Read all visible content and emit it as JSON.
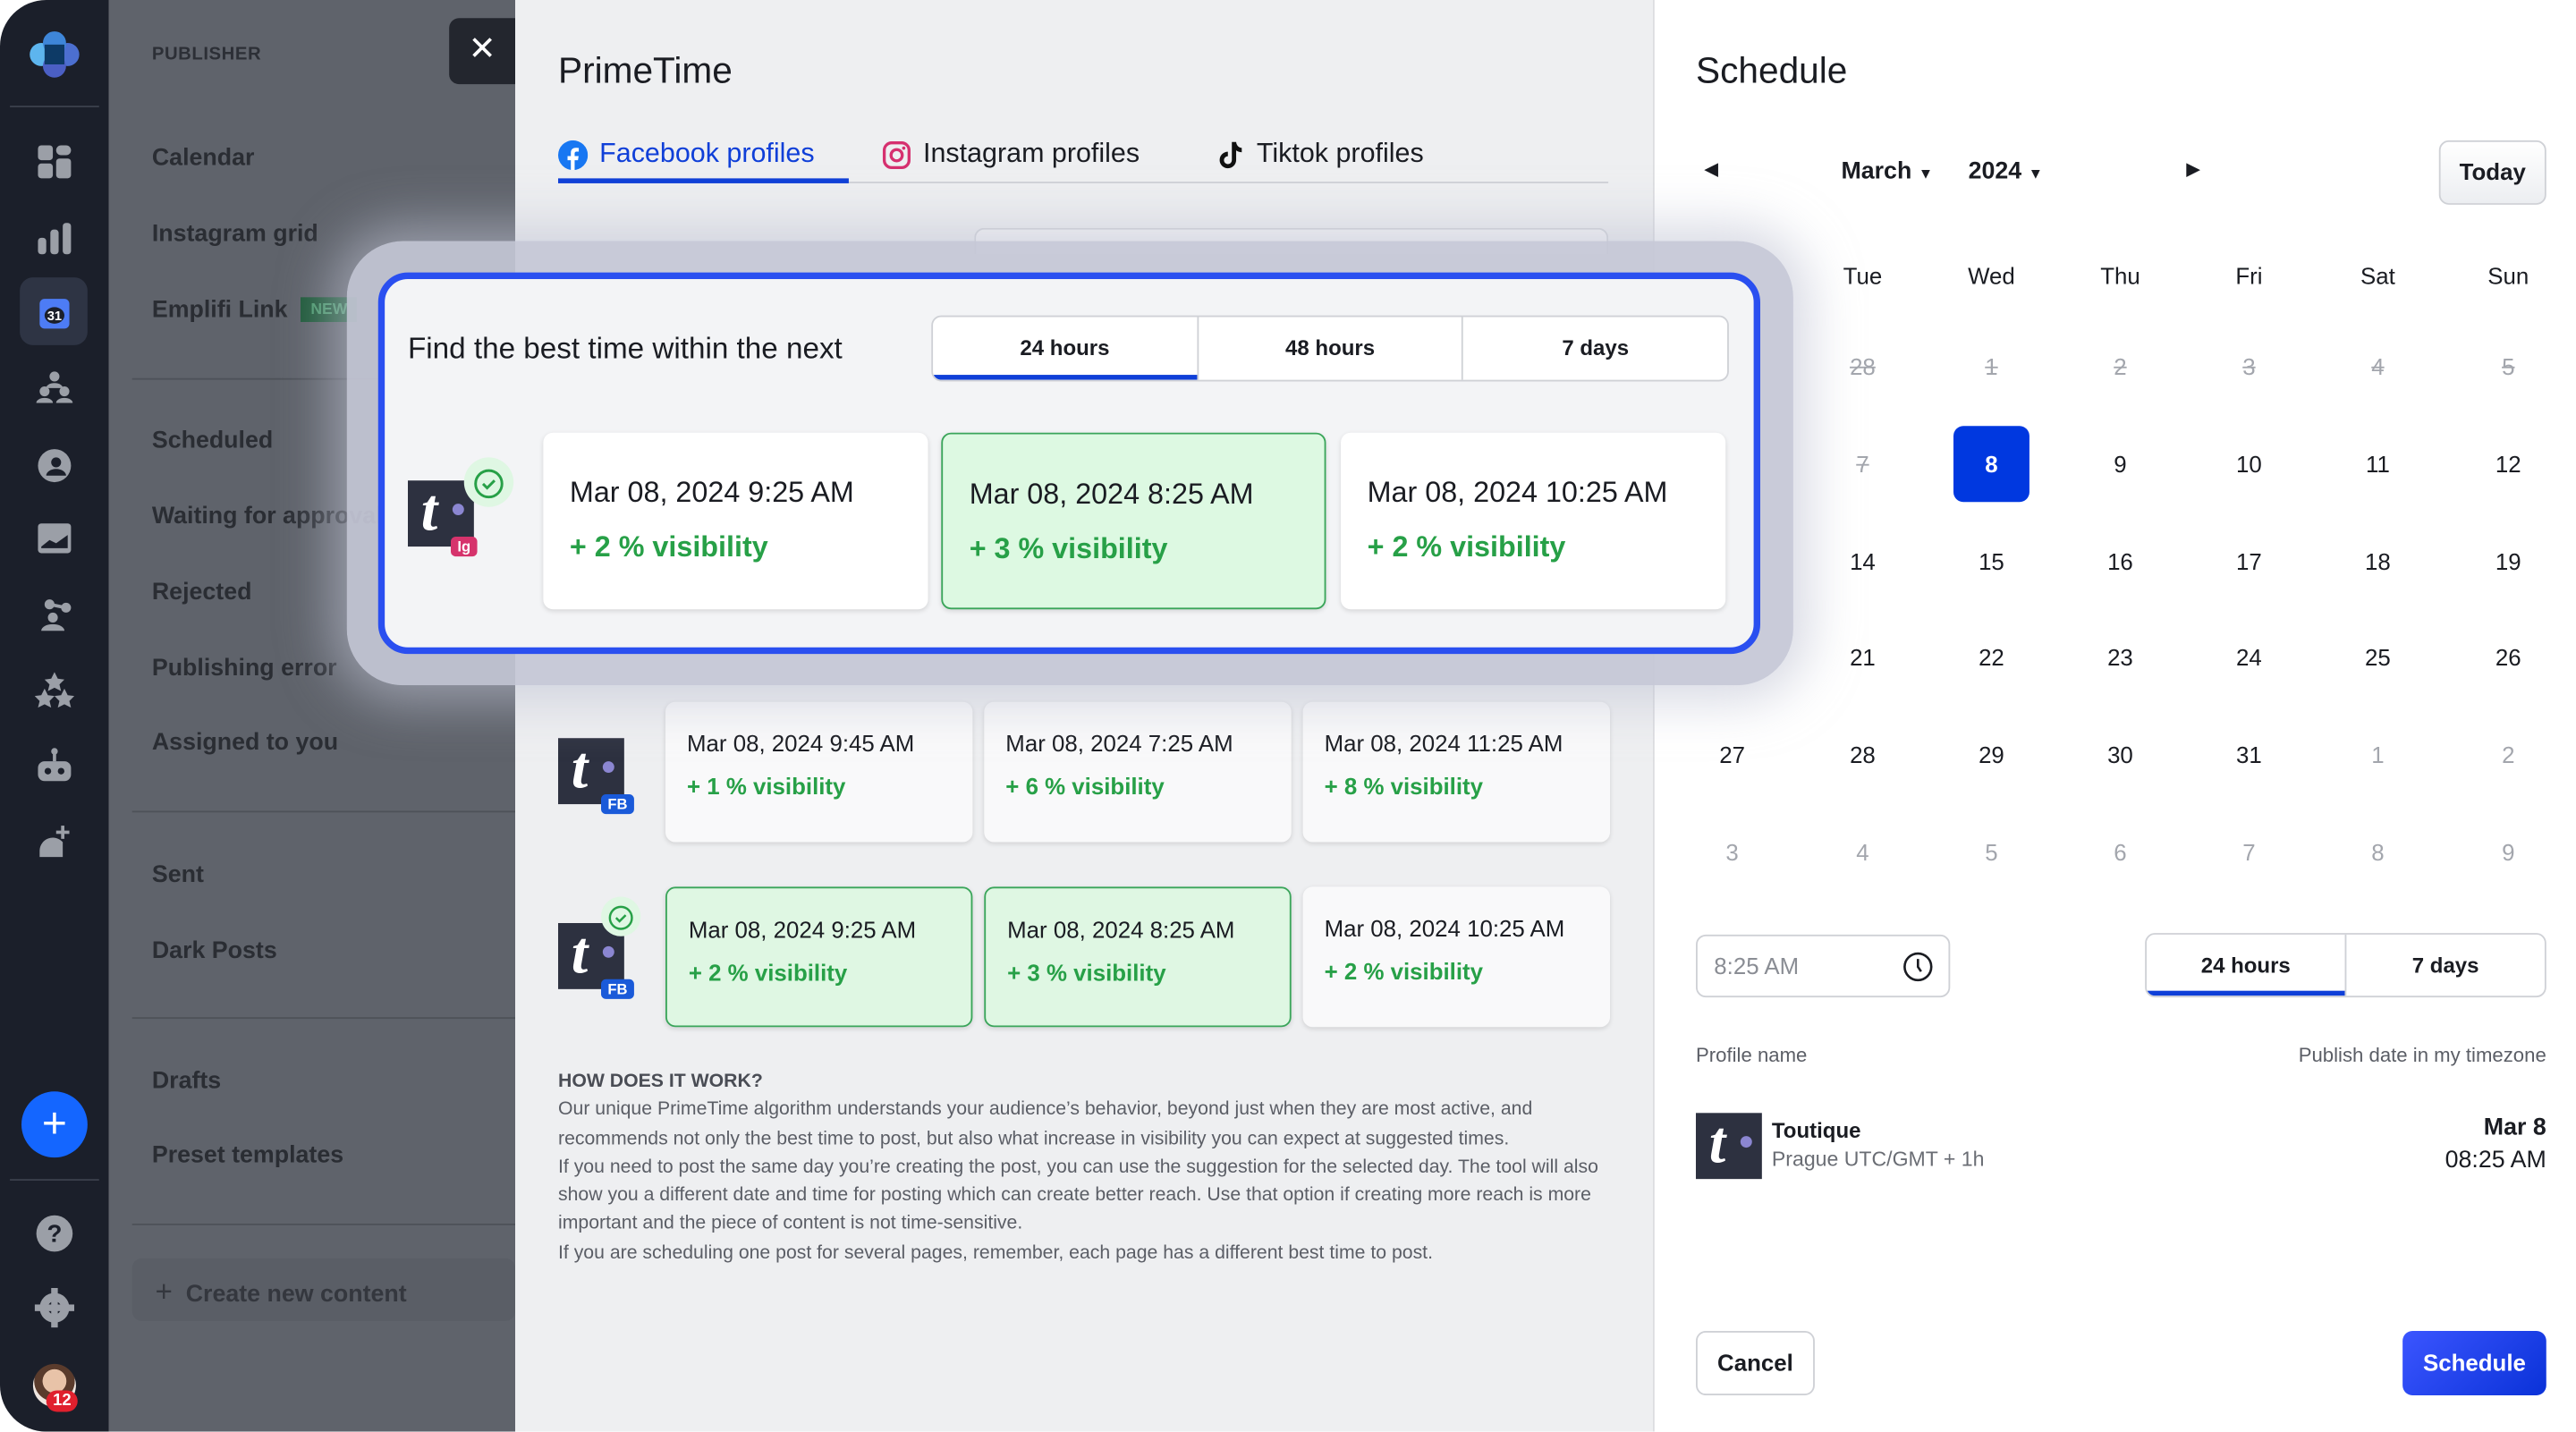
{
  "colors": {
    "accent": "#0f3fd8",
    "selected_day": "#0038e0",
    "success": "#27a047",
    "best_bg": "#ddf9e2",
    "rail": "#1b1f2a",
    "badge_ig": "#d6336c",
    "badge_fb": "#1a5ad9"
  },
  "rail": {
    "items": [
      "dashboard-icon",
      "analytics-icon",
      "calendar-icon",
      "community-icon",
      "care-icon",
      "media-icon",
      "influencer-icon",
      "reviews-icon",
      "bot-icon",
      "listening-icon"
    ],
    "active": "calendar-icon",
    "calendar_day": "31",
    "notifications": "12"
  },
  "nav": {
    "header": "PUBLISHER",
    "groups": [
      [
        "Calendar",
        "Instagram grid",
        "Emplifi Link"
      ],
      [
        "Scheduled",
        "Waiting for approval",
        "Rejected",
        "Publishing error",
        "Assigned to you"
      ],
      [
        "Sent",
        "Dark Posts"
      ],
      [
        "Drafts",
        "Preset templates"
      ]
    ],
    "new_badge": "NEW",
    "create_label": "Create new content"
  },
  "primetime": {
    "title": "PrimeTime",
    "tabs": [
      {
        "label": "Facebook profiles",
        "icon": "facebook-icon",
        "active": true
      },
      {
        "label": "Instagram profiles",
        "icon": "instagram-icon"
      },
      {
        "label": "Tiktok profiles",
        "icon": "tiktok-icon"
      }
    ],
    "popup": {
      "question": "Find the best time within the next",
      "ranges": [
        "24 hours",
        "48 hours",
        "7 days"
      ],
      "active_range": "24 hours",
      "badge": "Ig",
      "slots": [
        {
          "date": "Mar 08, 2024 9:25 AM",
          "visibility": "+ 2 % visibility"
        },
        {
          "date": "Mar 08, 2024 8:25 AM",
          "visibility": "+ 3 % visibility",
          "best": true
        },
        {
          "date": "Mar 08, 2024 10:25 AM",
          "visibility": "+ 2 % visibility"
        }
      ]
    },
    "rows": [
      {
        "badge": "FB",
        "slots": [
          {
            "date": "Mar 08, 2024 9:45 AM",
            "visibility": "+ 1 % visibility"
          },
          {
            "date": "Mar 08, 2024 7:25 AM",
            "visibility": "+ 6 % visibility"
          },
          {
            "date": "Mar 08, 2024 11:25 AM",
            "visibility": "+ 8 % visibility"
          }
        ]
      },
      {
        "badge": "FB",
        "alarm": true,
        "slots": [
          {
            "date": "Mar 08, 2024 9:25 AM",
            "visibility": "+ 2 % visibility",
            "best": true
          },
          {
            "date": "Mar 08, 2024 8:25 AM",
            "visibility": "+ 3 % visibility",
            "best": true
          },
          {
            "date": "Mar 08, 2024 10:25 AM",
            "visibility": "+ 2 % visibility"
          }
        ]
      }
    ],
    "how": {
      "heading": "HOW DOES IT WORK?",
      "paragraphs": [
        "Our unique PrimeTime algorithm understands your audience’s behavior, beyond just when they are most active, and recommends not only the best time to post, but also what increase in visibility you can expect at suggested times.",
        "If you need to post the same day you’re creating the post, you can use the suggestion for the selected day. The tool will also show you a different date and time for posting which can create better reach. Use that option if creating more reach is more important and the piece of content is not time-sensitive.",
        "If you are scheduling one post for several pages, remember, each page has a different best time to post."
      ]
    }
  },
  "schedule": {
    "title": "Schedule",
    "month": "March",
    "year": "2024",
    "today_label": "Today",
    "weekdays": [
      "",
      "Tue",
      "Wed",
      "Thu",
      "Fri",
      "Sat",
      "Sun"
    ],
    "weeks": [
      [
        {
          "d": ""
        },
        {
          "d": "28",
          "s": "past"
        },
        {
          "d": "1",
          "s": "past"
        },
        {
          "d": "2",
          "s": "past"
        },
        {
          "d": "3",
          "s": "past"
        },
        {
          "d": "4",
          "s": "past"
        },
        {
          "d": "5",
          "s": "past"
        }
      ],
      [
        {
          "d": ""
        },
        {
          "d": "7",
          "s": "past"
        },
        {
          "d": "8",
          "s": "sel"
        },
        {
          "d": "9"
        },
        {
          "d": "10"
        },
        {
          "d": "11"
        },
        {
          "d": "12"
        }
      ],
      [
        {
          "d": ""
        },
        {
          "d": "14"
        },
        {
          "d": "15"
        },
        {
          "d": "16"
        },
        {
          "d": "17"
        },
        {
          "d": "18"
        },
        {
          "d": "19"
        }
      ],
      [
        {
          "d": ""
        },
        {
          "d": "21"
        },
        {
          "d": "22"
        },
        {
          "d": "23"
        },
        {
          "d": "24"
        },
        {
          "d": "25"
        },
        {
          "d": "26"
        }
      ],
      [
        {
          "d": "27"
        },
        {
          "d": "28"
        },
        {
          "d": "29"
        },
        {
          "d": "30"
        },
        {
          "d": "31"
        },
        {
          "d": "1",
          "s": "other"
        },
        {
          "d": "2",
          "s": "other"
        }
      ],
      [
        {
          "d": "3",
          "s": "other"
        },
        {
          "d": "4",
          "s": "other"
        },
        {
          "d": "5",
          "s": "other"
        },
        {
          "d": "6",
          "s": "other"
        },
        {
          "d": "7",
          "s": "other"
        },
        {
          "d": "8",
          "s": "other"
        },
        {
          "d": "9",
          "s": "other"
        }
      ]
    ],
    "time_value": "8:25 AM",
    "ranges": [
      "24 hours",
      "7 days"
    ],
    "active_range": "24 hours",
    "col_profile": "Profile name",
    "col_date": "Publish date in my timezone",
    "profile": {
      "name": "Toutique",
      "timezone": "Prague UTC/GMT + 1h",
      "date": "Mar 8",
      "time": "08:25 AM"
    },
    "cancel_label": "Cancel",
    "schedule_label": "Schedule"
  }
}
